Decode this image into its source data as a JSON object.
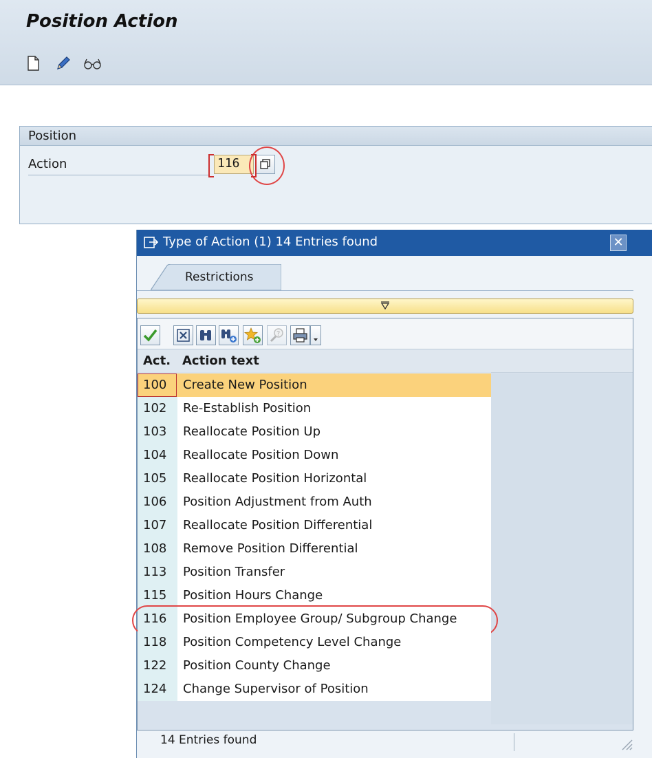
{
  "window": {
    "title": "Position Action"
  },
  "toolbar": {
    "icons": [
      "new-document-icon",
      "pencil-edit-icon",
      "glasses-display-icon"
    ]
  },
  "group": {
    "title": "Position",
    "action_label": "Action",
    "action_value": "116"
  },
  "popup": {
    "title": "Type of Action (1)  14 Entries found",
    "close_glyph": "✕",
    "tab_label": "Restrictions",
    "toolbar_icons": [
      "checkmark-icon",
      "cancel-icon",
      "binoculars-icon",
      "binoculars-plus-icon",
      "personal-list-icon",
      "help-icon",
      "print-icon",
      "dropdown-arrow-icon"
    ],
    "columns": {
      "act": "Act.",
      "text": "Action text"
    },
    "rows": [
      {
        "code": "100",
        "text": "Create New Position"
      },
      {
        "code": "102",
        "text": "Re-Establish Position"
      },
      {
        "code": "103",
        "text": "Reallocate Position Up"
      },
      {
        "code": "104",
        "text": "Reallocate Position Down"
      },
      {
        "code": "105",
        "text": "Reallocate Position Horizontal"
      },
      {
        "code": "106",
        "text": "Position Adjustment from Auth"
      },
      {
        "code": "107",
        "text": "Reallocate Position Differential"
      },
      {
        "code": "108",
        "text": "Remove Position Differential"
      },
      {
        "code": "113",
        "text": "Position Transfer"
      },
      {
        "code": "115",
        "text": "Position Hours Change"
      },
      {
        "code": "116",
        "text": "Position Employee Group/ Subgroup Change"
      },
      {
        "code": "118",
        "text": "Position Competency Level Change"
      },
      {
        "code": "122",
        "text": "Position County Change"
      },
      {
        "code": "124",
        "text": "Change Supervisor of Position"
      }
    ],
    "status": "14 Entries found"
  },
  "colors": {
    "popup_bar": "#1f5aa4",
    "selected_row": "#fbd27c",
    "highlight_circle": "#e04545",
    "input_bg": "#fbe9b8"
  }
}
